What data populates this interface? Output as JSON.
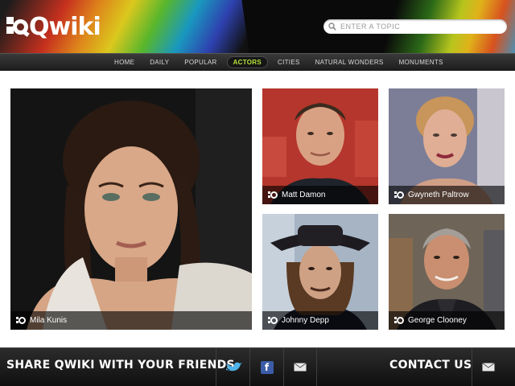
{
  "app": {
    "logo_text": "Qwiki",
    "logo_icon": "qwiki-logo-icon"
  },
  "search": {
    "placeholder": "ENTER A TOPIC",
    "value": "",
    "icon": "search-icon"
  },
  "nav": {
    "active": "ACTORS",
    "accent_color": "#b8e63a",
    "items": [
      "HOME",
      "DAILY",
      "POPULAR",
      "ACTORS",
      "CITIES",
      "NATURAL WONDERS",
      "MONUMENTS"
    ]
  },
  "tiles": [
    {
      "name": "Mila Kunis",
      "icon": "qwiki-mark-icon"
    },
    {
      "name": "Matt Damon",
      "icon": "qwiki-mark-icon"
    },
    {
      "name": "Gwyneth Paltrow",
      "icon": "qwiki-mark-icon"
    },
    {
      "name": "Johnny Depp",
      "icon": "qwiki-mark-icon"
    },
    {
      "name": "George Clooney",
      "icon": "qwiki-mark-icon"
    }
  ],
  "footer": {
    "share_label": "SHARE QWIKI WITH YOUR FRIENDS",
    "contact_label": "CONTACT US",
    "icons": [
      "twitter-icon",
      "facebook-icon",
      "mail-icon",
      "mail-icon"
    ],
    "facebook_glyph": "f"
  }
}
